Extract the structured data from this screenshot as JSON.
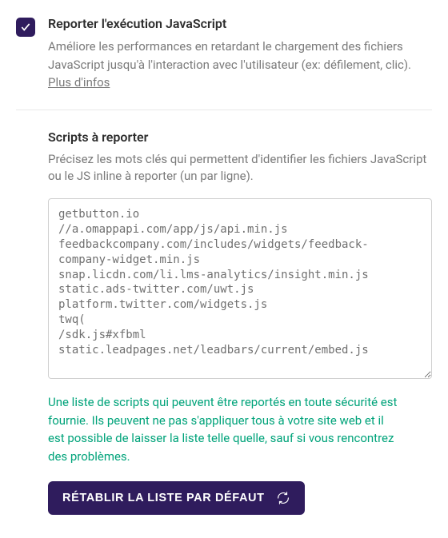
{
  "header": {
    "title": "Reporter l'exécution JavaScript",
    "description_pre": "Améliore les performances en retardant le chargement des fichiers JavaScript jusqu'à l'interaction avec l'utilisateur (ex: défilement, clic). ",
    "more_info": "Plus d'infos"
  },
  "scripts": {
    "title": "Scripts à reporter",
    "description": "Précisez les mots clés qui permettent d'identifier les fichiers JavaScript ou le JS inline à reporter (un par ligne).",
    "value": "getbutton.io\n//a.omappapi.com/app/js/api.min.js\nfeedbackcompany.com/includes/widgets/feedback-company-widget.min.js\nsnap.licdn.com/li.lms-analytics/insight.min.js\nstatic.ads-twitter.com/uwt.js\nplatform.twitter.com/widgets.js\ntwq(\n/sdk.js#xfbml\nstatic.leadpages.net/leadbars/current/embed.js",
    "hint": "Une liste de scripts qui peuvent être reportés en toute sécurité est fournie. Ils peuvent ne pas s'appliquer tous à votre site web et il est possible de laisser la liste telle quelle, sauf si vous rencontrez des problèmes.",
    "restore_button": "RÉTABLIR LA LISTE PAR DÉFAUT"
  }
}
